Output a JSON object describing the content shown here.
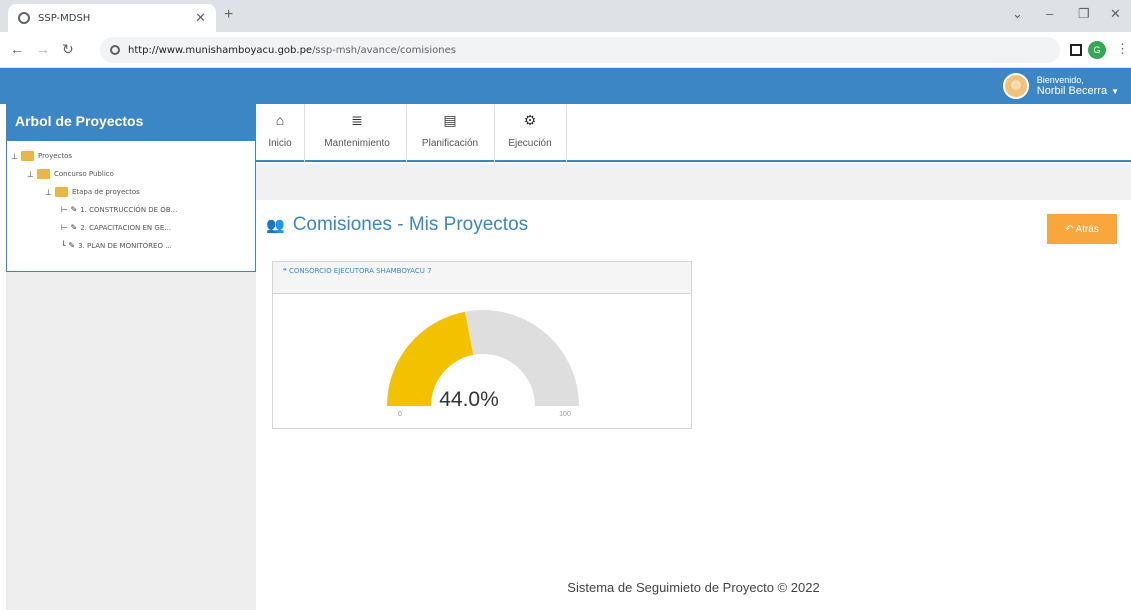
{
  "browser": {
    "tab_title": "SSP-MDSH",
    "url_host": "http://www.munishamboyacu.gob.pe",
    "url_path": "/ssp-msh/avance/comisiones",
    "profile_initial": "G"
  },
  "header": {
    "greeting": "Bienvenido,",
    "user_name": "Norbil Becerra",
    "bar_color": "#3d86c6"
  },
  "sidebar": {
    "title": "Arbol de Proyectos",
    "tree": [
      {
        "label": "Proyectos",
        "level": 0,
        "type": "folder"
      },
      {
        "label": "Concurso Publico",
        "level": 1,
        "type": "folder"
      },
      {
        "label": "Etapa de proyectos",
        "level": 2,
        "type": "folder"
      },
      {
        "label": "1. CONSTRUCCIÓN DE OB...",
        "level": 3,
        "type": "item"
      },
      {
        "label": "2. CAPACITACION EN GE...",
        "level": 3,
        "type": "item"
      },
      {
        "label": "3. PLAN DE MONITOREO ...",
        "level": 3,
        "type": "item"
      }
    ]
  },
  "toolbar": {
    "items": [
      {
        "label": "Inicio",
        "icon": "home-icon"
      },
      {
        "label": "Mantenimiento",
        "icon": "database-icon"
      },
      {
        "label": "Planificación",
        "icon": "building-icon"
      },
      {
        "label": "Ejecución",
        "icon": "gears-icon"
      }
    ]
  },
  "main": {
    "title": "Comisiones - Mis Proyectos",
    "back_label": "Atrás",
    "back_color": "#f9a73d",
    "card": {
      "title": "CONSORCIO EJECUTORA SHAMBOYACU 7",
      "gauge": {
        "value": 44.0,
        "value_label": "44.0%",
        "min_label": "0",
        "max_label": "100",
        "fill_color": "#f2c200",
        "track_color": "#dedede"
      }
    }
  },
  "footer": {
    "text": "Sistema de Seguimieto de Proyecto © 2022"
  }
}
